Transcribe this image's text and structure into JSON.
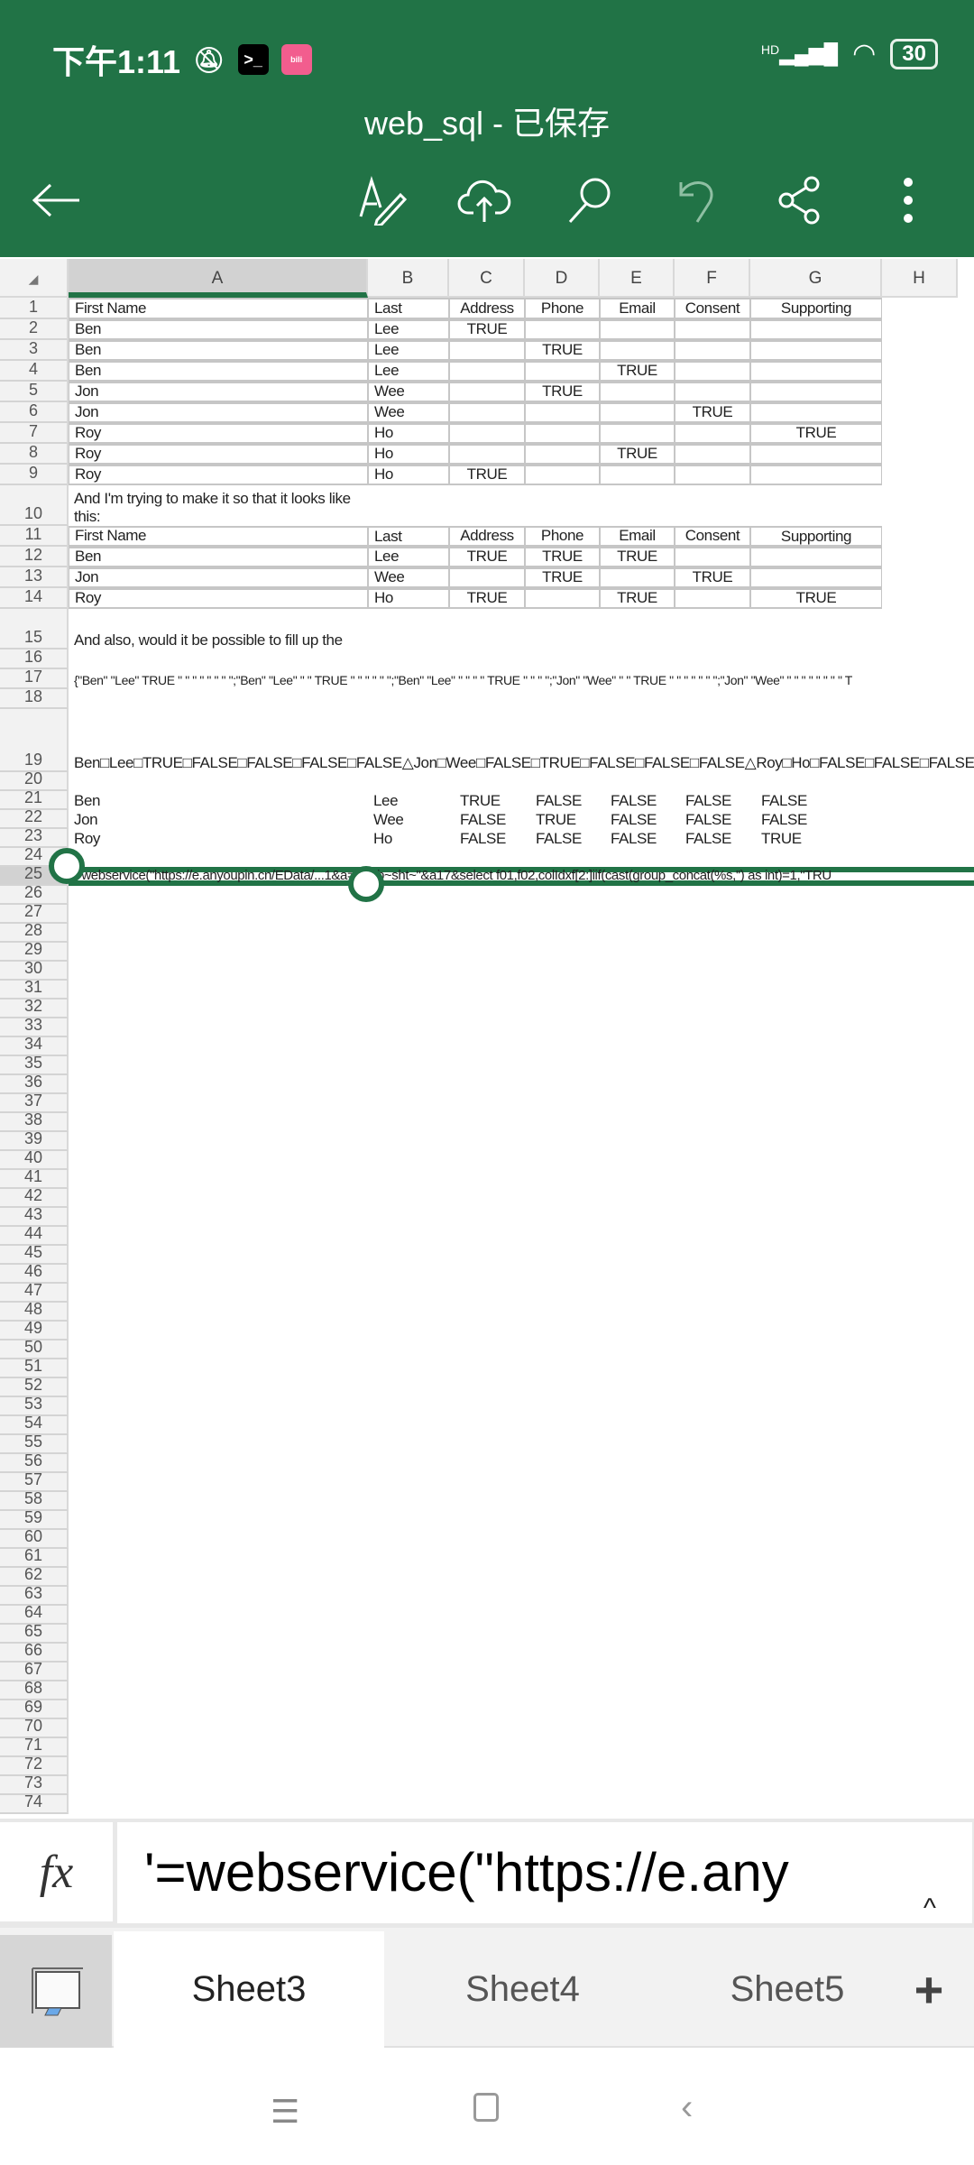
{
  "status_bar": {
    "time": "下午1:11",
    "signal": "HD",
    "battery": "30"
  },
  "header": {
    "title": "web_sql - 已保存"
  },
  "toolbar": {
    "icons": [
      "back-arrow-icon",
      "edit-pen-icon",
      "cloud-upload-icon",
      "search-icon",
      "undo-icon",
      "share-icon",
      "more-vertical-icon"
    ]
  },
  "columns": [
    "A",
    "B",
    "C",
    "D",
    "E",
    "F",
    "G",
    "H"
  ],
  "row_numbers": [
    "1",
    "2",
    "3",
    "4",
    "5",
    "6",
    "7",
    "8",
    "9",
    "10",
    "11",
    "12",
    "13",
    "14",
    "15",
    "16",
    "17",
    "18",
    "19",
    "20",
    "21",
    "22",
    "23",
    "24",
    "25",
    "26",
    "27",
    "28",
    "29",
    "30",
    "31",
    "32",
    "33",
    "34",
    "35",
    "36",
    "37",
    "38",
    "39",
    "40",
    "41",
    "42",
    "43",
    "44",
    "45",
    "46",
    "47",
    "48",
    "49",
    "50",
    "51",
    "52",
    "53",
    "54",
    "55",
    "56",
    "57",
    "58",
    "59",
    "60",
    "61",
    "62",
    "63",
    "64",
    "65",
    "66",
    "67",
    "68",
    "69",
    "70",
    "71",
    "72",
    "73",
    "74"
  ],
  "cells": {
    "1": [
      "First Name",
      "Last",
      "Address",
      "Phone",
      "Email",
      "Consent",
      "Supporting"
    ],
    "2": [
      "Ben",
      "Lee",
      "TRUE",
      "",
      "",
      "",
      ""
    ],
    "3": [
      "Ben",
      "Lee",
      "",
      "TRUE",
      "",
      "",
      ""
    ],
    "4": [
      "Ben",
      "Lee",
      "",
      "",
      "TRUE",
      "",
      ""
    ],
    "5": [
      "Jon",
      "Wee",
      "",
      "TRUE",
      "",
      "",
      ""
    ],
    "6": [
      "Jon",
      "Wee",
      "",
      "",
      "",
      "TRUE",
      ""
    ],
    "7": [
      "Roy",
      "Ho",
      "",
      "",
      "",
      "",
      "TRUE"
    ],
    "8": [
      "Roy",
      "Ho",
      "",
      "",
      "TRUE",
      "",
      ""
    ],
    "9": [
      "Roy",
      "Ho",
      "TRUE",
      "",
      "",
      "",
      ""
    ],
    "10": [
      "And I'm trying to make it so that it looks like this:"
    ],
    "11": [
      "First Name",
      "Last",
      "Address",
      "Phone",
      "Email",
      "Consent",
      "Supporting"
    ],
    "12": [
      "Ben",
      "Lee",
      "TRUE",
      "TRUE",
      "TRUE",
      "",
      ""
    ],
    "13": [
      "Jon",
      "Wee",
      "",
      "TRUE",
      "",
      "TRUE",
      ""
    ],
    "14": [
      "Roy",
      "Ho",
      "TRUE",
      "",
      "TRUE",
      "",
      "TRUE"
    ],
    "15": [
      "And also, would it be possible to fill up the"
    ],
    "17": [
      "{\"Ben\" \"Lee\" TRUE \" \" \" \" \" \" \" \";\"Ben\" \"Lee\" \" \" TRUE \" \" \" \" \" \";\"Ben\" \"Lee\" \" \" \" \" TRUE \" \" \" \";\"Jon\" \"Wee\" \" \" TRUE \" \" \" \" \" \" \";\"Jon\" \"Wee\" \" \" \" \" \" \" \" \" T"
    ],
    "19": [
      "Ben□Lee□TRUE□FALSE□FALSE□FALSE□FALSE△Jon□Wee□FALSE□TRUE□FALSE□FALSE□FALSE△Roy□Ho□FALSE□FALSE□FALSE□FALSE□TRUE"
    ],
    "21": [
      "Ben",
      "Lee",
      "TRUE",
      "FALSE",
      "FALSE",
      "FALSE",
      "FALSE"
    ],
    "22": [
      "Jon",
      "Wee",
      "FALSE",
      "TRUE",
      "FALSE",
      "FALSE",
      "FALSE"
    ],
    "23": [
      "Roy",
      "Ho",
      "FALSE",
      "FALSE",
      "FALSE",
      "FALSE",
      "TRUE"
    ],
    "25": [
      "=webservice(\"https://e.anyoupin.cn/EData/...1&a=cli_tb~sht~\"&a17&select f01,f02,colIdxf[2:]iif(cast(group_concat(%s,'') as int)=1,\"TRU"
    ]
  },
  "formula_bar": {
    "label": "fx",
    "value": "'=webservice(\"https://e.any"
  },
  "sheet_tabs": [
    {
      "label": "Sheet3",
      "active": true
    },
    {
      "label": "Sheet4",
      "active": false
    },
    {
      "label": "Sheet5",
      "active": false
    }
  ],
  "add_sheet": "+",
  "colors": {
    "brand": "#217346"
  }
}
